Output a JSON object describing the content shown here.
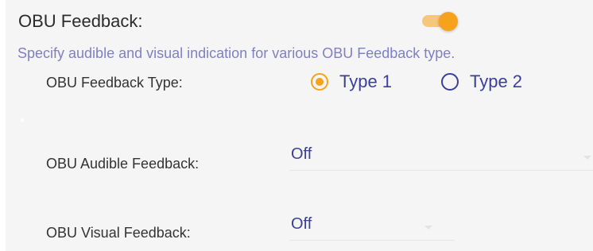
{
  "section": {
    "title": "OBU Feedback:",
    "enabled": true,
    "description": "Specify audible and visual indication for various OBU Feedback type."
  },
  "feedback_type": {
    "label": "OBU Feedback Type:",
    "options": [
      {
        "label": "Type 1",
        "selected": true
      },
      {
        "label": "Type 2",
        "selected": false
      }
    ]
  },
  "audible": {
    "label": "OBU Audible Feedback:",
    "value": "Off"
  },
  "visual": {
    "label": "OBU Visual Feedback:",
    "value": "Off"
  },
  "colors": {
    "accent": "#f7a21b",
    "primary": "#3a3f98",
    "description": "#7f7fc6"
  },
  "icons": [
    "toggle-switch",
    "radio-checked-icon",
    "radio-unchecked-icon",
    "dropdown-caret-icon"
  ]
}
